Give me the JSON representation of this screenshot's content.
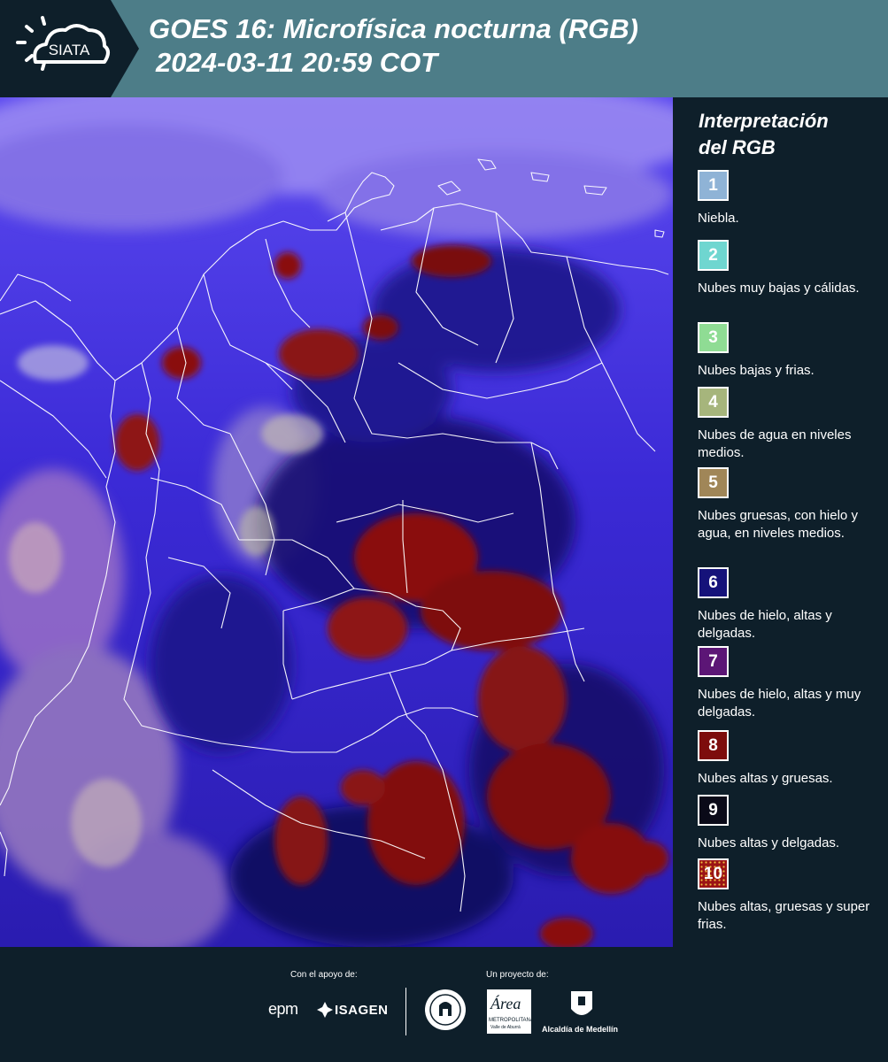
{
  "header": {
    "brand": "SIATA",
    "title": "GOES 16: Microfísica nocturna (RGB)",
    "datetime": "2024-03-11 20:59 COT"
  },
  "map": {
    "background_color": "#3b2ad6",
    "border_color": "#ffffff"
  },
  "legend": {
    "title_line1": "Interpretación",
    "title_line2": "del RGB",
    "items": [
      {
        "num": "1",
        "color": "#8fb3d6",
        "label": "Niebla."
      },
      {
        "num": "2",
        "color": "#6fd6d0",
        "label": "Nubes muy bajas y cálidas."
      },
      {
        "num": "3",
        "color": "#8fdc94",
        "label": "Nubes bajas y frias."
      },
      {
        "num": "4",
        "color": "#a6b57c",
        "label": "Nubes de agua en niveles medios."
      },
      {
        "num": "5",
        "color": "#a08658",
        "label": "Nubes gruesas, con hielo y agua, en niveles medios."
      },
      {
        "num": "6",
        "color": "#15127a",
        "label": "Nubes de hielo, altas y delgadas."
      },
      {
        "num": "7",
        "color": "#5c1676",
        "label": "Nubes de hielo, altas y muy delgadas."
      },
      {
        "num": "8",
        "color": "#7d0c0c",
        "label": "Nubes altas y gruesas."
      },
      {
        "num": "9",
        "color": "#0a0a18",
        "label": "Nubes altas y delgadas."
      },
      {
        "num": "10",
        "color": "#9b1414",
        "label": "Nubes altas, gruesas y super frias."
      }
    ]
  },
  "footer": {
    "support_caption": "Con el apoyo de:",
    "project_caption": "Un proyecto de:",
    "epm": "epm",
    "isagen": "ISAGEN",
    "area_line1": "Área",
    "area_line2": "METROPOLITANA",
    "area_line3": "Valle de Aburrá",
    "alcaldia": "Alcaldía de Medellín"
  }
}
